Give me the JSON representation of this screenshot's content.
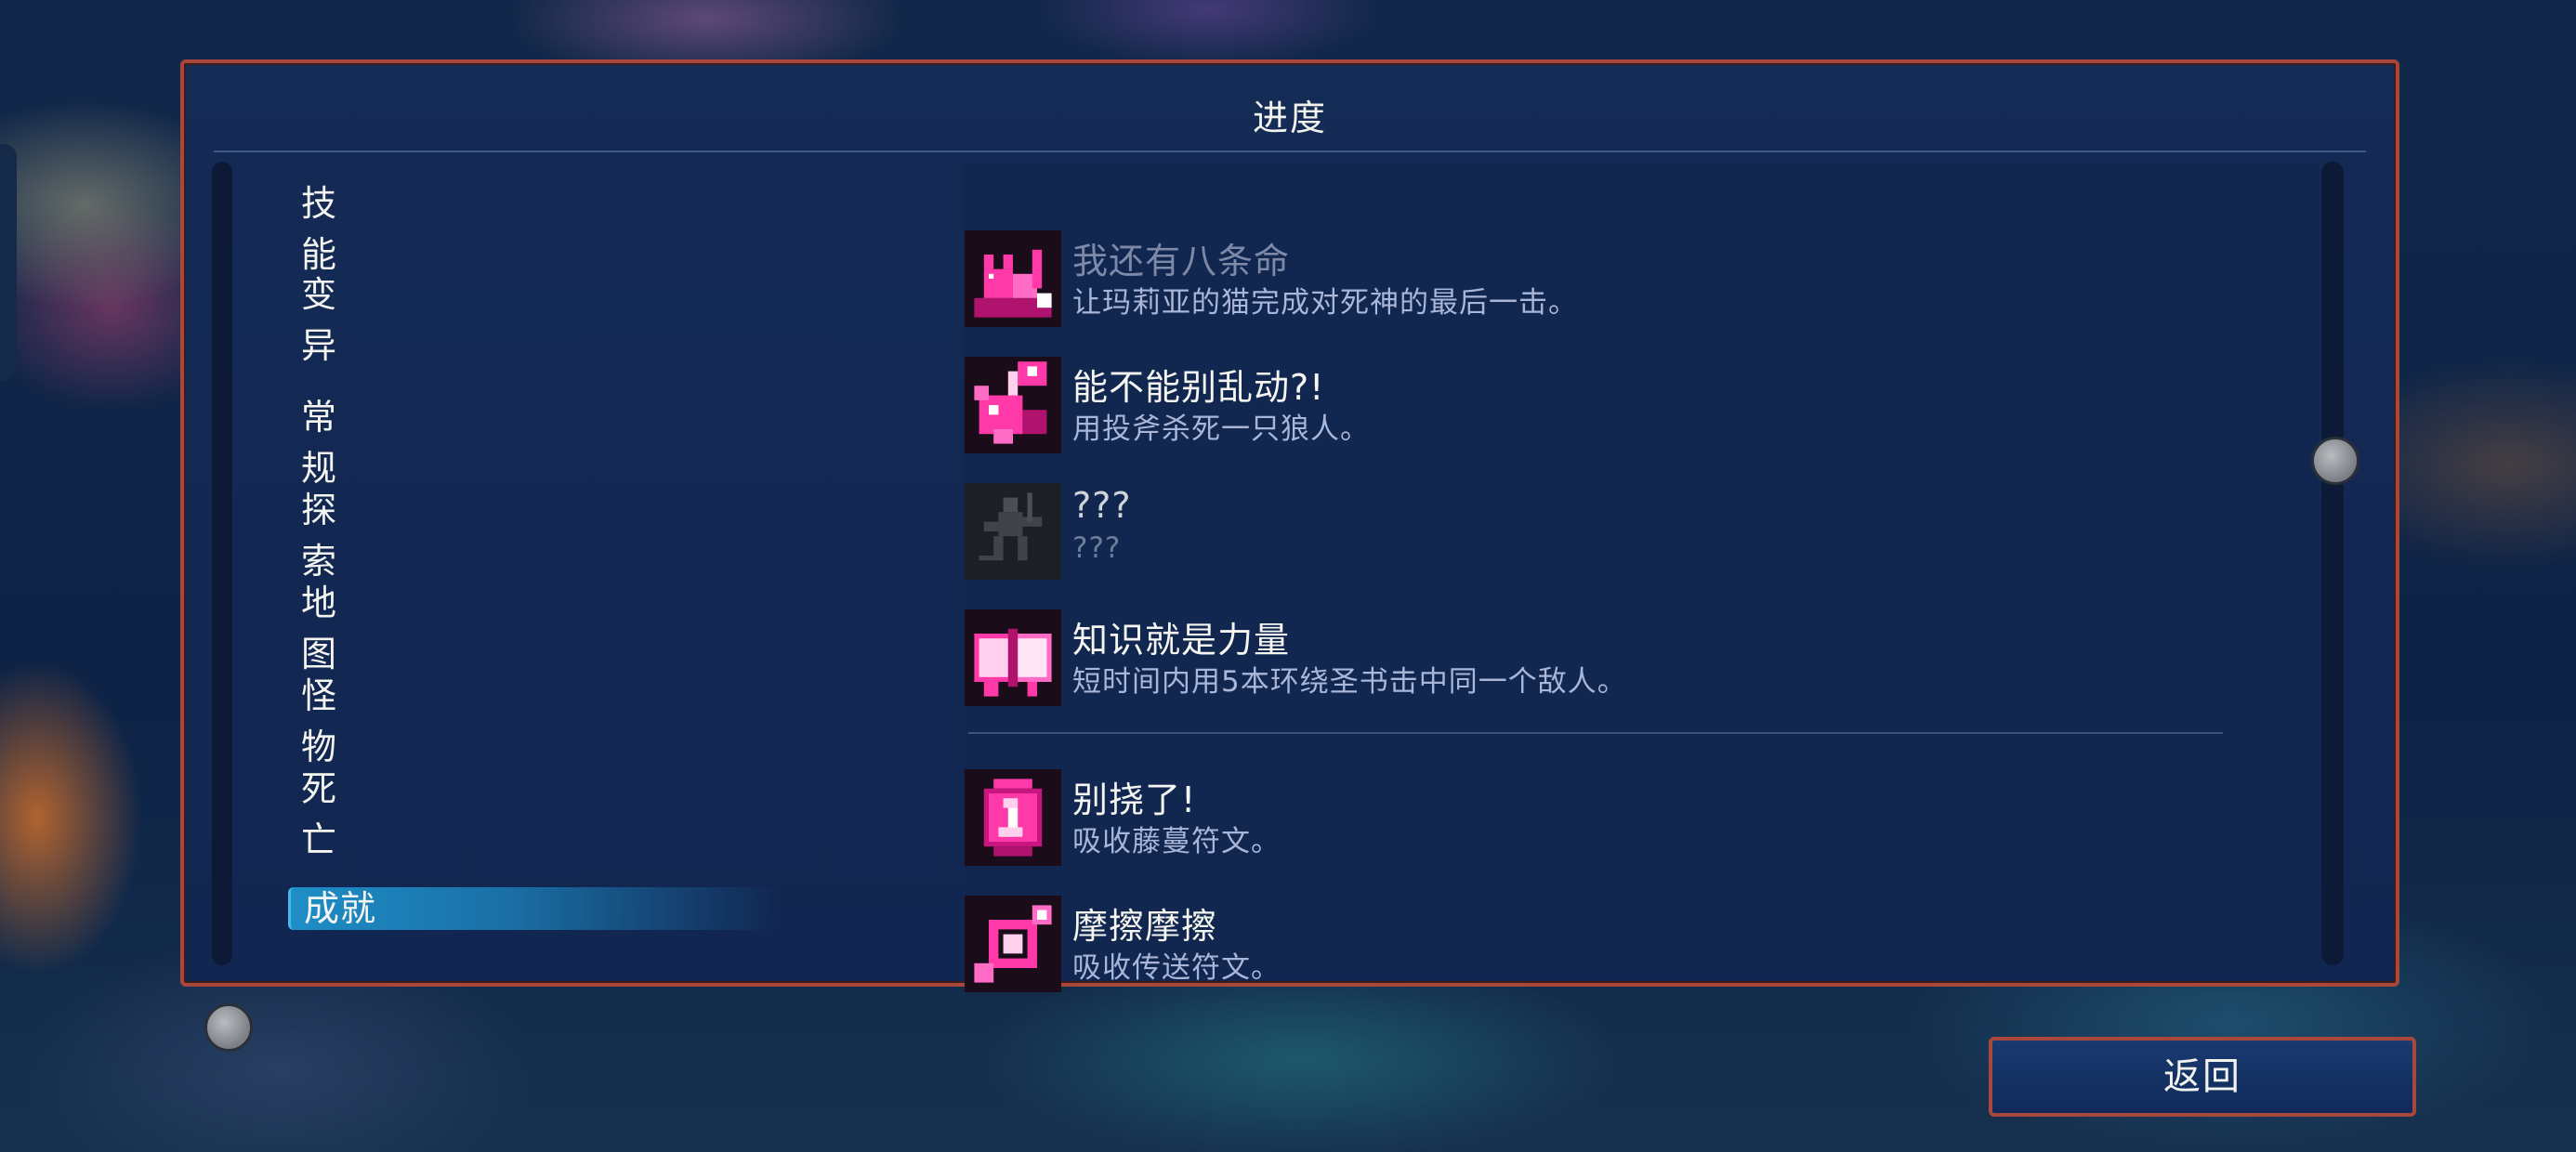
{
  "panel": {
    "title": "进度"
  },
  "nav": {
    "items": [
      {
        "label": "技能"
      },
      {
        "label": "变异"
      },
      {
        "label": "常规"
      },
      {
        "label": "探索"
      },
      {
        "label": "地图"
      },
      {
        "label": "怪物"
      },
      {
        "label": "死亡"
      },
      {
        "label": "成就"
      }
    ],
    "selected": "成就"
  },
  "achievements": [
    {
      "name": "我还有八条命",
      "desc": "让玛莉亚的猫完成对死神的最后一击。",
      "icon": "cat-icon",
      "state": "partially-scrolled"
    },
    {
      "name": "能不能别乱动?!",
      "desc": "用投斧杀死一只狼人。",
      "icon": "axe-werewolf-icon",
      "state": "unlocked"
    },
    {
      "name": "???",
      "desc": "???",
      "icon": "locked-figure-icon",
      "state": "hidden"
    },
    {
      "name": "知识就是力量",
      "desc": "短时间内用5本环绕圣书击中同一个敌人。",
      "icon": "book-icon",
      "state": "unlocked"
    },
    {
      "name": "别挠了!",
      "desc": "吸收藤蔓符文。",
      "icon": "vine-rune-icon",
      "state": "unlocked"
    },
    {
      "name": "摩擦摩擦",
      "desc": "吸收传送符文。",
      "icon": "teleport-rune-icon",
      "state": "unlocked"
    }
  ],
  "footer": {
    "back_label": "返回"
  },
  "colors": {
    "accent": "#1e8ec7",
    "frame": "#a8473a",
    "icon_pink": "#ff3aa8"
  }
}
